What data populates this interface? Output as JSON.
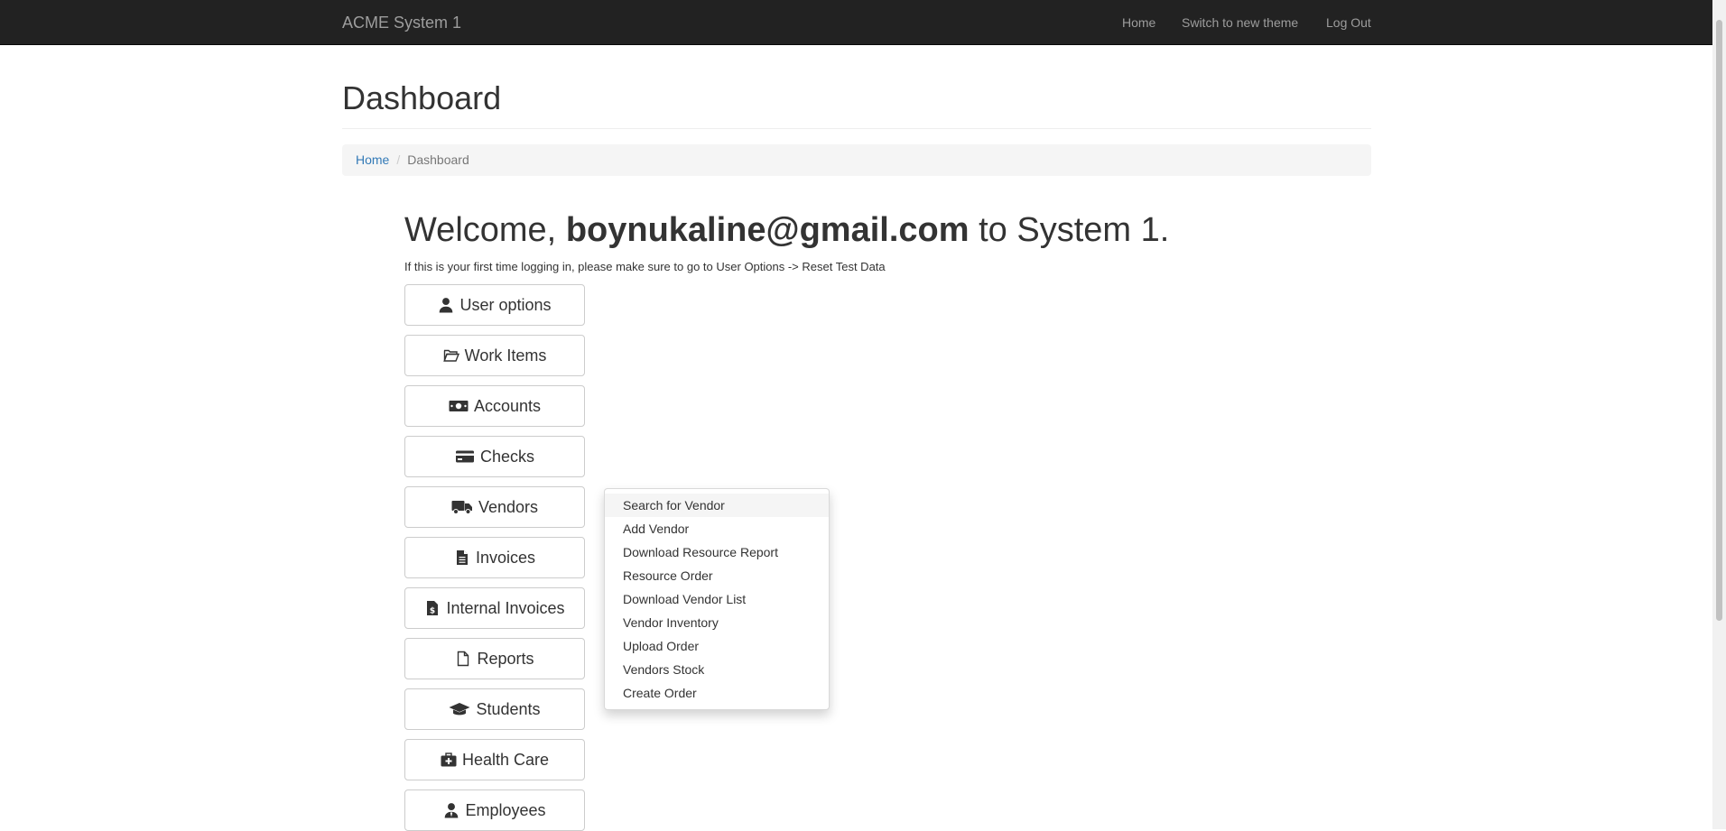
{
  "navbar": {
    "brand": "ACME System 1",
    "links": [
      "Home",
      "Switch to new theme",
      "Log Out"
    ]
  },
  "page": {
    "title": "Dashboard"
  },
  "breadcrumb": {
    "home": "Home",
    "separator": "/",
    "current": "Dashboard"
  },
  "welcome": {
    "prefix": "Welcome,",
    "user": "boynukaline@gmail.com",
    "suffix": "to System 1.",
    "hint": "If this is your first time logging in, please make sure to go to User Options -> Reset Test Data"
  },
  "menu_buttons": [
    {
      "label": "User options",
      "icon": "user-icon"
    },
    {
      "label": "Work Items",
      "icon": "folder-open-icon"
    },
    {
      "label": "Accounts",
      "icon": "money-bill-icon"
    },
    {
      "label": "Checks",
      "icon": "credit-card-icon"
    },
    {
      "label": "Vendors",
      "icon": "truck-icon"
    },
    {
      "label": "Invoices",
      "icon": "file-text-icon"
    },
    {
      "label": "Internal Invoices",
      "icon": "file-invoice-dollar-icon"
    },
    {
      "label": "Reports",
      "icon": "file-icon"
    },
    {
      "label": "Students",
      "icon": "graduation-cap-icon"
    },
    {
      "label": "Health Care",
      "icon": "medkit-icon"
    },
    {
      "label": "Employees",
      "icon": "user-tie-icon"
    }
  ],
  "vendors_dropdown": {
    "items": [
      "Search for Vendor",
      "Add Vendor",
      "Download Resource Report",
      "Resource Order",
      "Download Vendor List",
      "Vendor Inventory",
      "Upload Order",
      "Vendors Stock",
      "Create Order"
    ]
  },
  "colors": {
    "navbar_bg": "#222222",
    "navbar_text": "#9d9d9d",
    "link": "#337ab7",
    "breadcrumb_bg": "#f5f5f5",
    "border": "#cccccc"
  }
}
